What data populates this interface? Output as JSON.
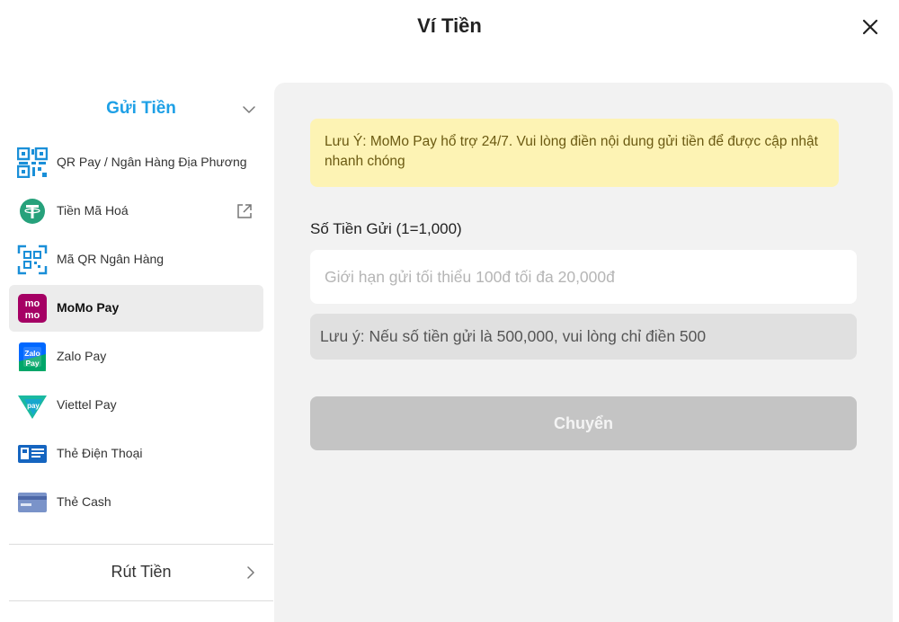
{
  "header": {
    "title": "Ví Tiền"
  },
  "sidebar": {
    "deposit_section": {
      "label": "Gửi Tiền"
    },
    "items": [
      {
        "label": "QR Pay / Ngân Hàng Địa Phương",
        "icon": "qr-pay-icon"
      },
      {
        "label": "Tiền Mã Hoá",
        "icon": "tether-icon"
      },
      {
        "label": "Mã QR Ngân Hàng",
        "icon": "qr-scan-icon"
      },
      {
        "label": "MoMo Pay",
        "icon": "momo-icon",
        "active": true
      },
      {
        "label": "Zalo Pay",
        "icon": "zalopay-icon"
      },
      {
        "label": "Viettel Pay",
        "icon": "viettelpay-icon"
      },
      {
        "label": "Thẻ Điện Thoại",
        "icon": "phone-card-icon"
      },
      {
        "label": "Thẻ Cash",
        "icon": "cash-card-icon"
      }
    ],
    "withdraw_section": {
      "label": "Rút Tiền"
    }
  },
  "main": {
    "notice": "Lưu Ý: MoMo Pay hổ trợ 24/7. Vui lòng điền nội dung gửi tiền để được cập nhật nhanh chóng",
    "amount_label": "Số Tiền Gửi (1=1,000)",
    "amount_placeholder": "Giới hạn gửi tối thiểu 100đ tối đa 20,000đ",
    "amount_value": "",
    "hint": "Lưu ý: Nếu số tiền gửi là 500,000, vui lòng chỉ điền 500",
    "submit_label": "Chuyển"
  },
  "colors": {
    "accent": "#1ea0e6",
    "notice_bg": "#fdf3b4",
    "momo": "#a50064",
    "disabled_button": "#c4c4c4"
  }
}
